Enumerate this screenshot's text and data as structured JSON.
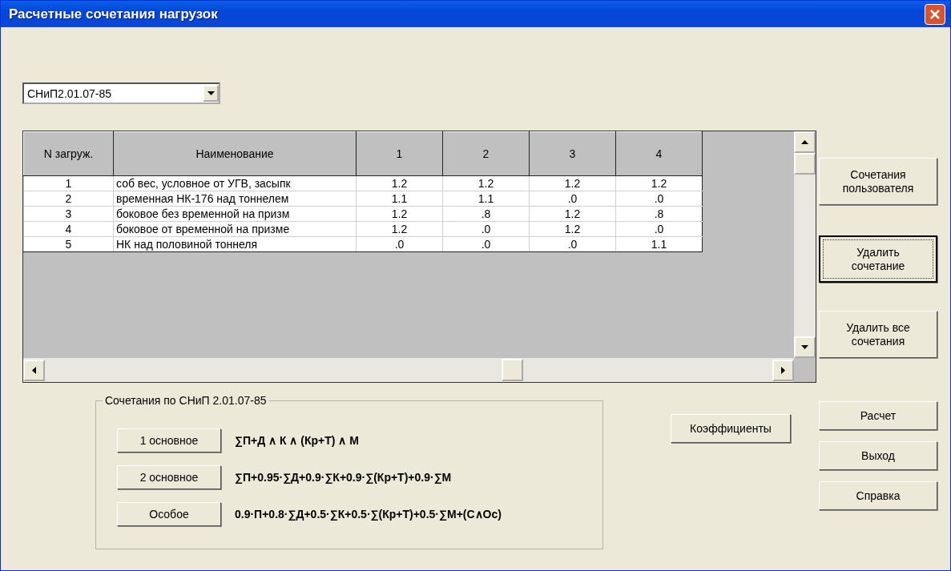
{
  "window": {
    "title": "Расчетные сочетания нагрузок"
  },
  "norm_select": {
    "value": "СНиП2.01.07-85"
  },
  "table": {
    "columns": [
      "N загруж.",
      "Наименование",
      "1",
      "2",
      "3",
      "4"
    ],
    "rows": [
      [
        "1",
        "соб вес, условное от УГВ, засыпк",
        "1.2",
        "1.2",
        "1.2",
        "1.2"
      ],
      [
        "2",
        "временная НК-176 над тоннелем",
        "1.1",
        "1.1",
        ".0",
        ".0"
      ],
      [
        "3",
        "боковое без временной на призм",
        "1.2",
        ".8",
        "1.2",
        ".8"
      ],
      [
        "4",
        "боковое от временной на призме",
        "1.2",
        ".0",
        "1.2",
        ".0"
      ],
      [
        "5",
        "НК над половиной тоннеля",
        ".0",
        ".0",
        ".0",
        "1.1"
      ]
    ]
  },
  "side_buttons": [
    {
      "label": "Сочетания пользователя",
      "focused": false
    },
    {
      "label": "Удалить сочетание",
      "focused": true
    },
    {
      "label": "Удалить все сочетания",
      "focused": false
    }
  ],
  "group": {
    "title": "Сочетания по СНиП 2.01.07-85",
    "items": [
      {
        "button": "1 основное",
        "formula": "∑П+Д ∧ К ∧ (Кр+Т) ∧ М"
      },
      {
        "button": "2 основное",
        "formula": "∑П+0.95·∑Д+0.9·∑К+0.9·∑(Кр+Т)+0.9·∑М"
      },
      {
        "button": "Особое",
        "formula": "0.9·П+0.8·∑Д+0.5·∑К+0.5·∑(Кр+Т)+0.5·∑М+(С∧Ос)"
      }
    ]
  },
  "coefficients_button": "Коэффициенты",
  "bottom_buttons": [
    "Расчет",
    "Выход",
    "Справка"
  ]
}
